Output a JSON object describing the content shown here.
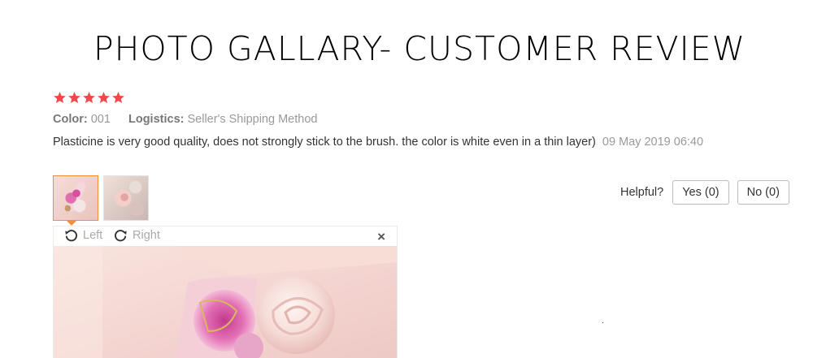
{
  "banner": {
    "title": "PHOTO GALLARY- CUSTOMER REVIEW"
  },
  "review": {
    "rating": 5,
    "max_rating": 5,
    "star_color": "#f0484b",
    "color_label": "Color:",
    "color_value": "001",
    "logistics_label": "Logistics:",
    "logistics_value": "Seller's Shipping Method",
    "comment": "Plasticine is very good quality, does not strongly stick to the brush. the color is white even in a thin layer)",
    "date": "09 May 2019 06:40",
    "thumbnails": [
      {
        "icon": "review-photo-thumbnail-1",
        "selected": true
      },
      {
        "icon": "review-photo-thumbnail-2",
        "selected": false
      }
    ],
    "helpful": {
      "label": "Helpful?",
      "yes_label": "Yes (0)",
      "no_label": "No (0)"
    }
  },
  "viewer": {
    "rotate_left_label": "Left",
    "rotate_right_label": "Right",
    "close_label": "×",
    "rotate_left_icon": "rotate-left-icon",
    "rotate_right_icon": "rotate-right-icon",
    "accent_color": "#f38f3a"
  }
}
